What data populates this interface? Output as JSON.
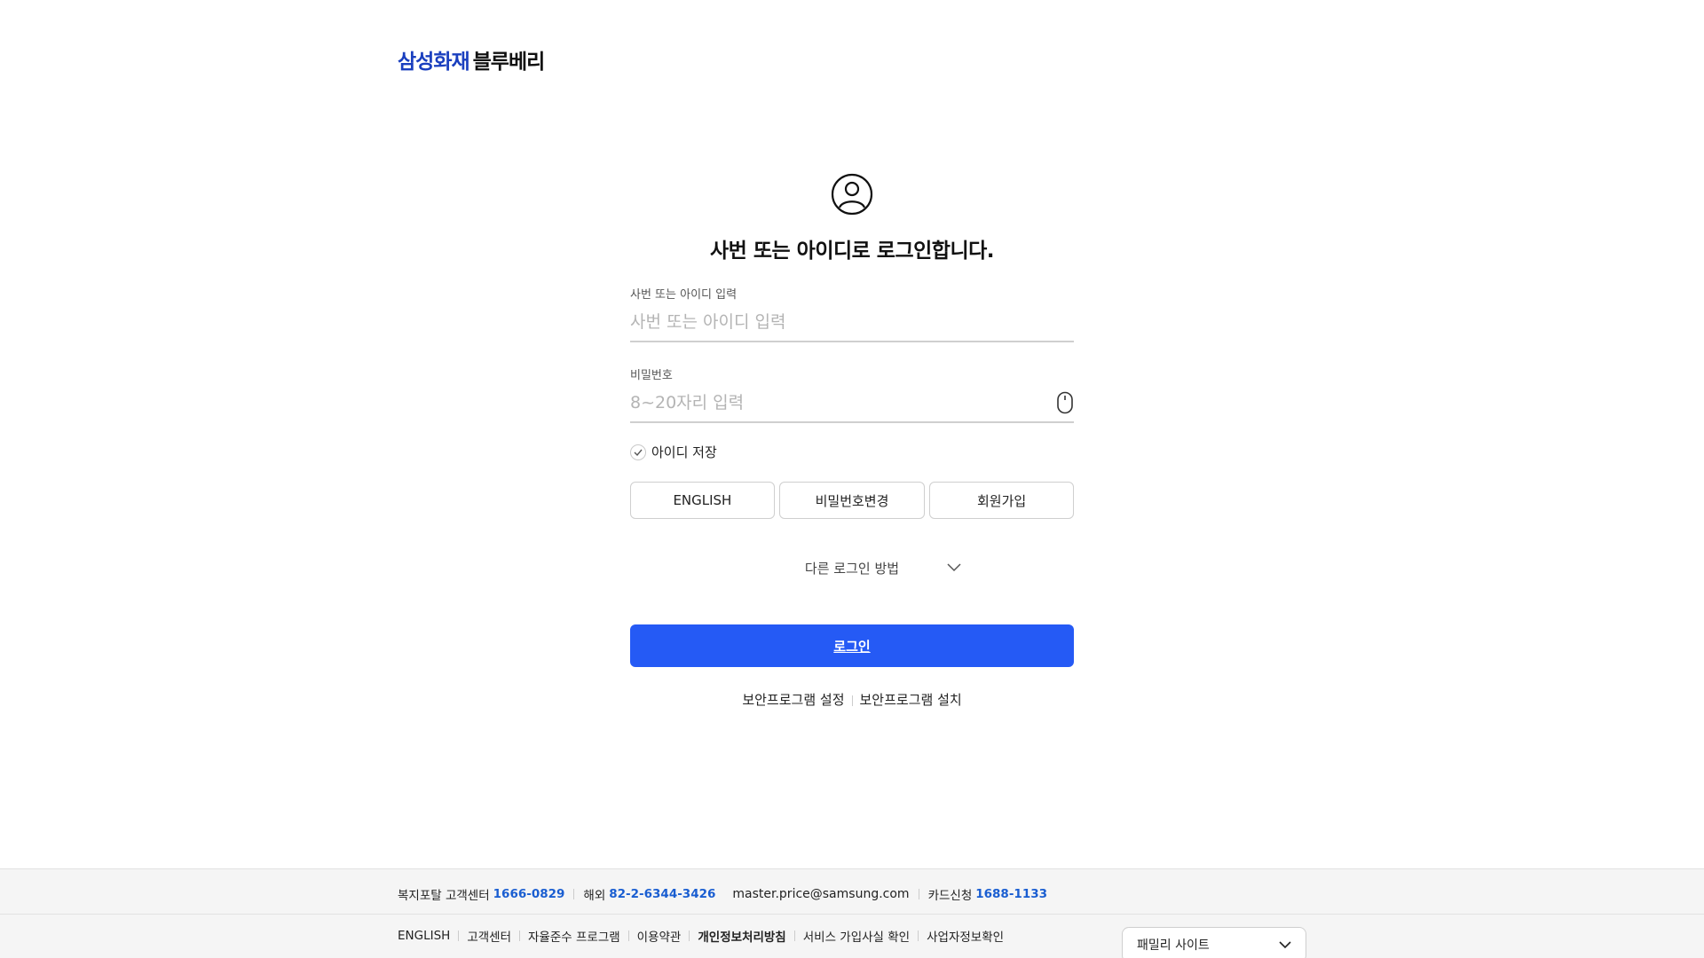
{
  "logo": {
    "brand": "삼성화재",
    "product": "블루베리"
  },
  "login": {
    "headline": "사번 또는 아이디로 로그인합니다.",
    "id_label": "사번 또는 아이디 입력",
    "id_placeholder": "사번 또는 아이디 입력",
    "pw_label": "비밀번호",
    "pw_placeholder": "8~20자리 입력",
    "remember_label": "아이디 저장",
    "remember_checked": true,
    "buttons": [
      "ENGLISH",
      "비밀번호변경",
      "회원가입"
    ],
    "other_login": "다른 로그인 방법",
    "submit": "로그인",
    "security_links": [
      "보안프로그램 설정",
      "보안프로그램 설치"
    ]
  },
  "footer": {
    "contact": {
      "welfare_label": "복지포탈 고객센터",
      "welfare_num": "1666-0829",
      "overseas_label": "해외",
      "overseas_num": "82-2-6344-3426",
      "email": "master.price@samsung.com",
      "card_label": "카드신청",
      "card_num": "1688-1133"
    },
    "links": [
      "ENGLISH",
      "고객센터",
      "자율준수 프로그램",
      "이용약관",
      "개인정보처리방침",
      "서비스 가입사실 확인",
      "사업자정보확인"
    ],
    "family_site": "패밀리 사이트"
  },
  "colors": {
    "brand": "#1a3fbf",
    "primary": "#255af5",
    "link_number": "#1a5ed1"
  },
  "icons": [
    "user-circle-icon",
    "eye-icon",
    "check-icon",
    "chevron-down-icon"
  ]
}
